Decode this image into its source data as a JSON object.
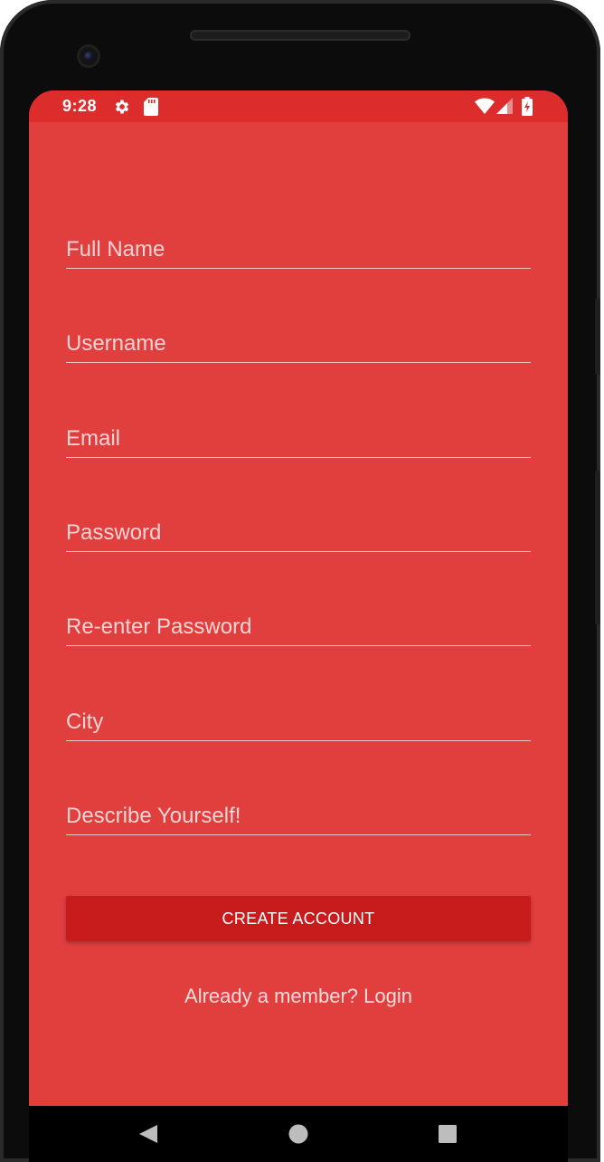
{
  "status_bar": {
    "time": "9:28",
    "left_icons": [
      "gear-icon",
      "sd-card-icon"
    ],
    "right_icons": [
      "wifi-icon",
      "signal-icon",
      "battery-charging-icon"
    ]
  },
  "form": {
    "fields": [
      {
        "name": "full-name",
        "placeholder": "Full Name",
        "value": ""
      },
      {
        "name": "username",
        "placeholder": "Username",
        "value": ""
      },
      {
        "name": "email",
        "placeholder": "Email",
        "value": ""
      },
      {
        "name": "password",
        "placeholder": "Password",
        "value": ""
      },
      {
        "name": "reenter-password",
        "placeholder": "Re-enter Password",
        "value": ""
      },
      {
        "name": "city",
        "placeholder": "City",
        "value": ""
      },
      {
        "name": "describe-yourself",
        "placeholder": "Describe Yourself!",
        "value": ""
      }
    ],
    "create_button_label": "CREATE ACCOUNT",
    "login_link_text": "Already a member? Login"
  },
  "navigation": {
    "buttons": [
      "back-icon",
      "home-icon",
      "recents-icon"
    ]
  },
  "colors": {
    "background": "#e13e3e",
    "status_bar": "#dd2c2c",
    "button": "#c81c1c"
  }
}
